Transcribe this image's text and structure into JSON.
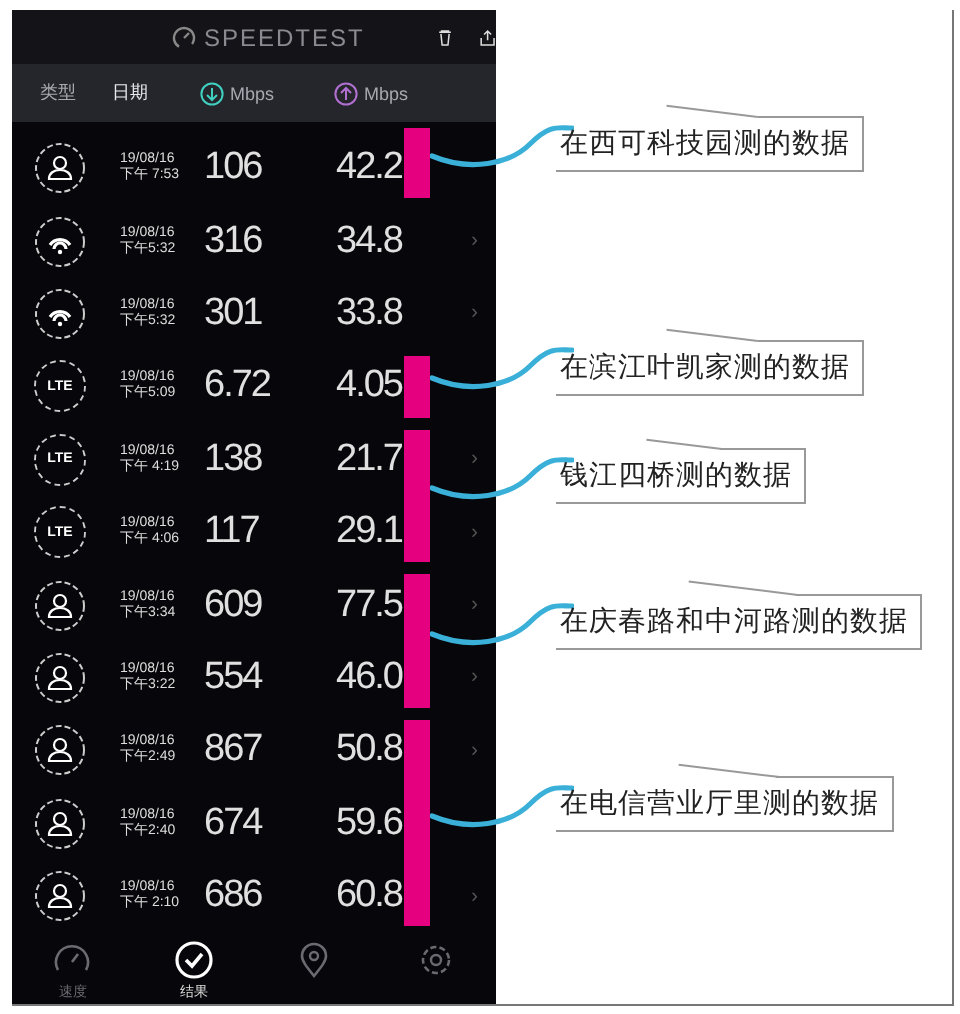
{
  "app_bar": {
    "title": "SPEEDTEST"
  },
  "columns": [
    {
      "label": "类型",
      "kind": "text"
    },
    {
      "label": "日期",
      "kind": "text"
    },
    {
      "label": "Mbps",
      "kind": "download"
    },
    {
      "label": "Mbps",
      "kind": "upload"
    }
  ],
  "groups": [
    {
      "marked": true,
      "note": "在西可科技园测的数据",
      "rows": [
        {
          "kind": "person",
          "date": "19/08/16",
          "time": "下午 7:53",
          "download": "106",
          "upload": "42.2"
        }
      ]
    },
    {
      "marked": false,
      "rows": [
        {
          "kind": "wifi",
          "date": "19/08/16",
          "time": "下午5:32",
          "download": "316",
          "upload": "34.8",
          "chevron": "›"
        },
        {
          "kind": "wifi",
          "date": "19/08/16",
          "time": "下午5:32",
          "download": "301",
          "upload": "33.8",
          "chevron": "›"
        }
      ]
    },
    {
      "marked": true,
      "note": "在滨江叶凯家测的数据",
      "rows": [
        {
          "kind": "lte",
          "network_label": "LTE",
          "date": "19/08/16",
          "time": "下午5:09",
          "download": "6.72",
          "upload": "4.05"
        }
      ]
    },
    {
      "marked": true,
      "note": "钱江四桥测的数据",
      "rows": [
        {
          "kind": "lte",
          "network_label": "LTE",
          "date": "19/08/16",
          "time": "下午 4:19",
          "download": "138",
          "upload": "21.7",
          "chevron": "›"
        },
        {
          "kind": "lte",
          "network_label": "LTE",
          "date": "19/08/16",
          "time": "下午 4:06",
          "download": "117",
          "upload": "29.1",
          "chevron": "›"
        }
      ]
    },
    {
      "marked": true,
      "note": "在庆春路和中河路测的数据",
      "rows": [
        {
          "kind": "person",
          "date": "19/08/16",
          "time": "下午3:34",
          "download": "609",
          "upload": "77.5",
          "chevron": "›"
        },
        {
          "kind": "person",
          "date": "19/08/16",
          "time": "下午3:22",
          "download": "554",
          "upload": "46.0",
          "chevron": "›"
        }
      ]
    },
    {
      "marked": true,
      "note": "在电信营业厅里测的数据",
      "rows": [
        {
          "kind": "person",
          "date": "19/08/16",
          "time": "下午2:49",
          "download": "867",
          "upload": "50.8",
          "chevron": "›"
        },
        {
          "kind": "person",
          "date": "19/08/16",
          "time": "下午2:40",
          "download": "674",
          "upload": "59.6"
        },
        {
          "kind": "person",
          "date": "19/08/16",
          "time": "下午 2:10",
          "download": "686",
          "upload": "60.8",
          "chevron": "›"
        }
      ]
    }
  ],
  "nav": [
    {
      "kind": "speed",
      "label": "速度",
      "selected": false
    },
    {
      "kind": "results",
      "label": "结果",
      "selected": true
    },
    {
      "kind": "map",
      "selected": false
    },
    {
      "kind": "settings",
      "selected": false
    }
  ]
}
